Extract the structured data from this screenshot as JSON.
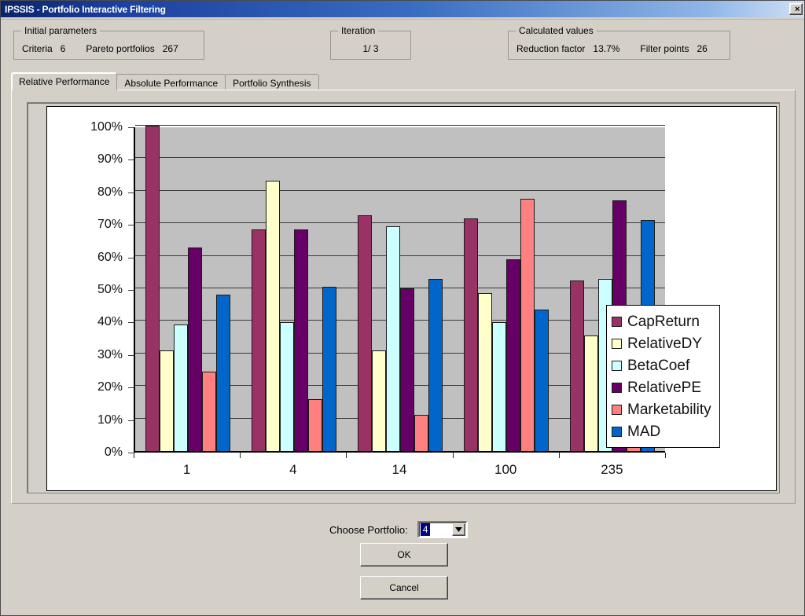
{
  "window": {
    "title": "IPSSIS - Portfolio Interactive Filtering",
    "close_label": "×",
    "close_icon": "close-icon"
  },
  "initial_parameters": {
    "legend": "Initial parameters",
    "criteria_label": "Criteria",
    "criteria_value": "6",
    "pareto_label": "Pareto portfolios",
    "pareto_value": "267"
  },
  "iteration": {
    "legend": "Iteration",
    "value": "1/ 3"
  },
  "calculated_values": {
    "legend": "Calculated values",
    "reduction_label": "Reduction factor",
    "reduction_value": "13.7%",
    "filter_label": "Filter points",
    "filter_value": "26"
  },
  "tabs": [
    {
      "label": "Relative Performance",
      "active": true
    },
    {
      "label": "Absolute Performance",
      "active": false
    },
    {
      "label": "Portfolio Synthesis",
      "active": false
    }
  ],
  "footer": {
    "choose_portfolio_label": "Choose Portfolio:",
    "selected_portfolio": "4",
    "dropdown_icon": "chevron-down-icon",
    "ok_label": "OK",
    "cancel_label": "Cancel"
  },
  "chart_data": {
    "type": "bar",
    "title": "",
    "xlabel": "",
    "ylabel": "",
    "grid": true,
    "legend_position": "right",
    "ylim": [
      0,
      100
    ],
    "ytick_labels": [
      "0%",
      "10%",
      "20%",
      "30%",
      "40%",
      "50%",
      "60%",
      "70%",
      "80%",
      "90%",
      "100%"
    ],
    "ytick_values": [
      0,
      10,
      20,
      30,
      40,
      50,
      60,
      70,
      80,
      90,
      100
    ],
    "categories": [
      "1",
      "4",
      "14",
      "100",
      "235"
    ],
    "series": [
      {
        "name": "CapReturn",
        "color": "#993366",
        "values": [
          100,
          68,
          72.5,
          71.5,
          52.5
        ]
      },
      {
        "name": "RelativeDY",
        "color": "#ffffcc",
        "values": [
          31,
          83,
          31,
          48.5,
          35.5
        ]
      },
      {
        "name": "BetaCoef",
        "color": "#ccffff",
        "values": [
          39,
          39.5,
          69,
          39.5,
          53
        ]
      },
      {
        "name": "RelativePE",
        "color": "#660066",
        "values": [
          62.5,
          68,
          50,
          59,
          77
        ]
      },
      {
        "name": "Marketability",
        "color": "#ff8080",
        "values": [
          24.5,
          16,
          11,
          77.5,
          12.5
        ]
      },
      {
        "name": "MAD",
        "color": "#0066cc",
        "values": [
          48,
          50.5,
          53,
          43.5,
          71
        ]
      }
    ]
  }
}
